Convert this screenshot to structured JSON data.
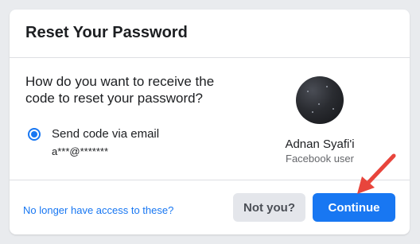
{
  "dialog": {
    "title": "Reset Your Password",
    "question": "How do you want to receive the code to reset your password?"
  },
  "option": {
    "label": "Send code via email",
    "value": "a***@*******",
    "selected": true
  },
  "user": {
    "name": "Adnan Syafi'i",
    "type": "Facebook user"
  },
  "footer": {
    "no_access_link": "No longer have access to these?",
    "not_you_label": "Not you?",
    "continue_label": "Continue"
  },
  "colors": {
    "accent": "#1877f2",
    "annotation_arrow": "#e8453c"
  },
  "icons": {
    "annotation": "red-arrow-icon"
  }
}
